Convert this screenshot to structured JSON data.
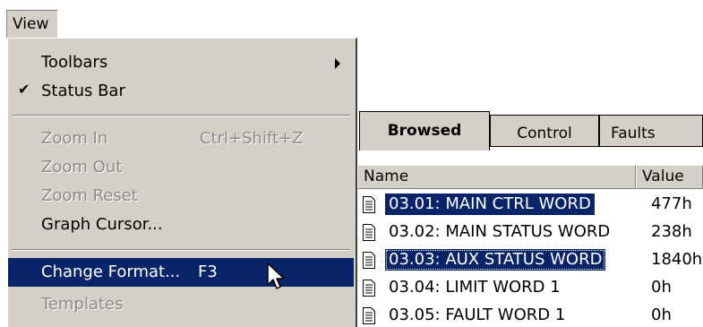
{
  "menubar": {
    "view_label": "View"
  },
  "view_menu": {
    "toolbars": "Toolbars",
    "status_bar": "Status Bar",
    "zoom_in": "Zoom In",
    "zoom_in_shortcut": "Ctrl+Shift+Z",
    "zoom_out": "Zoom Out",
    "zoom_reset": "Zoom Reset",
    "graph_cursor": "Graph Cursor...",
    "change_format": "Change Format...",
    "change_format_shortcut": "F3",
    "templates": "Templates"
  },
  "tabs": {
    "browsed": "Browsed",
    "control": "Control",
    "faults": "Faults"
  },
  "list": {
    "col_name": "Name",
    "col_value": "Value",
    "rows": [
      {
        "name": "03.01: MAIN CTRL WORD",
        "value": "477h"
      },
      {
        "name": "03.02: MAIN STATUS WORD",
        "value": "238h"
      },
      {
        "name": "03.03: AUX STATUS WORD",
        "value": "1840h"
      },
      {
        "name": "03.04: LIMIT WORD 1",
        "value": "0h"
      },
      {
        "name": "03.05: FAULT WORD 1",
        "value": "0h"
      }
    ]
  },
  "colors": {
    "menu_bg": "#d4d0c8",
    "highlight": "#0a246a",
    "disabled_text": "#8a8a8a"
  }
}
